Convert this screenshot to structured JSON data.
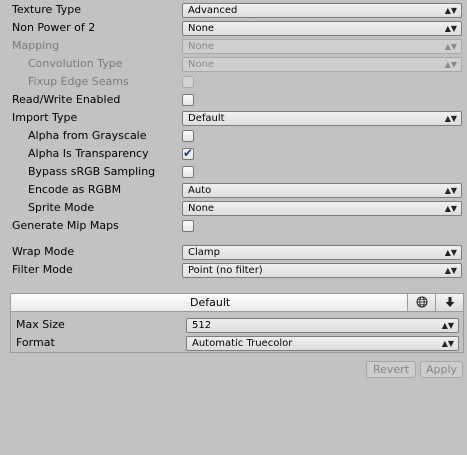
{
  "settings": {
    "texture_type": {
      "label": "Texture Type",
      "value": "Advanced"
    },
    "non_power_of_2": {
      "label": "Non Power of 2",
      "value": "None"
    },
    "mapping": {
      "label": "Mapping",
      "value": "None"
    },
    "convolution_type": {
      "label": "Convolution Type",
      "value": "None"
    },
    "fixup_edge_seams": {
      "label": "Fixup Edge Seams"
    },
    "read_write_enabled": {
      "label": "Read/Write Enabled"
    },
    "import_type": {
      "label": "Import Type",
      "value": "Default"
    },
    "alpha_from_grayscale": {
      "label": "Alpha from Grayscale"
    },
    "alpha_is_transparency": {
      "label": "Alpha Is Transparency",
      "checkmark": "✔"
    },
    "bypass_srgb": {
      "label": "Bypass sRGB Sampling"
    },
    "encode_as_rgbm": {
      "label": "Encode as RGBM",
      "value": "Auto"
    },
    "sprite_mode": {
      "label": "Sprite Mode",
      "value": "None"
    },
    "generate_mip_maps": {
      "label": "Generate Mip Maps"
    },
    "wrap_mode": {
      "label": "Wrap Mode",
      "value": "Clamp"
    },
    "filter_mode": {
      "label": "Filter Mode",
      "value": "Point (no filter)"
    }
  },
  "platform_panel": {
    "tab_label": "Default",
    "max_size": {
      "label": "Max Size",
      "value": "512"
    },
    "format": {
      "label": "Format",
      "value": "Automatic Truecolor"
    }
  },
  "buttons": {
    "revert": "Revert",
    "apply": "Apply"
  },
  "icons": {
    "dropdown_arrow": "updown-arrow-icon",
    "globe": "globe-icon",
    "download": "download-icon"
  }
}
